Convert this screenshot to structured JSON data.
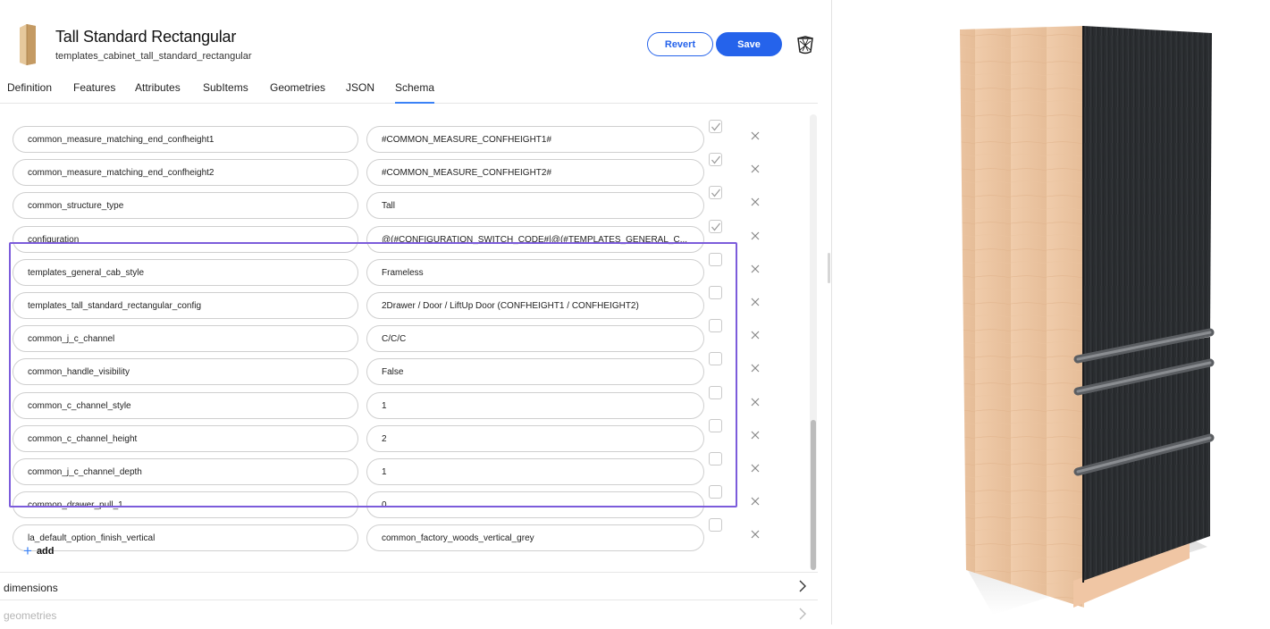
{
  "header": {
    "title": "Tall Standard Rectangular",
    "subtitle": "templates_cabinet_tall_standard_rectangular",
    "revert_label": "Revert",
    "save_label": "Save",
    "accent_color": "#2563eb",
    "icons": [
      "cabinet-thumbnail-icon",
      "trash-icon"
    ]
  },
  "tabs": [
    {
      "label": "Definition",
      "active": false
    },
    {
      "label": "Features",
      "active": false
    },
    {
      "label": "Attributes",
      "active": false
    },
    {
      "label": "SubItems",
      "active": false
    },
    {
      "label": "Geometries",
      "active": false
    },
    {
      "label": "JSON",
      "active": false
    },
    {
      "label": "Schema",
      "active": true
    }
  ],
  "rows": [
    {
      "key": "common_measure_matching_end_confheight1",
      "value": "#COMMON_MEASURE_CONFHEIGHT1#",
      "checked": true
    },
    {
      "key": "common_measure_matching_end_confheight2",
      "value": "#COMMON_MEASURE_CONFHEIGHT2#",
      "checked": true
    },
    {
      "key": "common_structure_type",
      "value": "Tall",
      "checked": true
    },
    {
      "key": "configuration",
      "value": "@(#CONFIGURATION_SWITCH_CODE#|@(#TEMPLATES_GENERAL_C...",
      "checked": true
    },
    {
      "key": "templates_general_cab_style",
      "value": "Frameless",
      "checked": false
    },
    {
      "key": "templates_tall_standard_rectangular_config",
      "value": "2Drawer / Door / LiftUp Door (CONFHEIGHT1 / CONFHEIGHT2)",
      "checked": false
    },
    {
      "key": "common_j_c_channel",
      "value": "C/C/C",
      "checked": false
    },
    {
      "key": "common_handle_visibility",
      "value": "False",
      "checked": false
    },
    {
      "key": "common_c_channel_style",
      "value": "1",
      "checked": false
    },
    {
      "key": "common_c_channel_height",
      "value": "2",
      "checked": false
    },
    {
      "key": "common_j_c_channel_depth",
      "value": "1",
      "checked": false
    },
    {
      "key": "common_drawer_pull_1",
      "value": "0",
      "checked": false
    },
    {
      "key": "la_default_option_finish_vertical",
      "value": "common_factory_woods_vertical_grey",
      "checked": false
    }
  ],
  "add_label": "add",
  "sections": [
    {
      "label": "dimensions",
      "muted": false
    },
    {
      "label": "geometries",
      "muted": true
    }
  ],
  "highlight_color": "#7c5cdb"
}
